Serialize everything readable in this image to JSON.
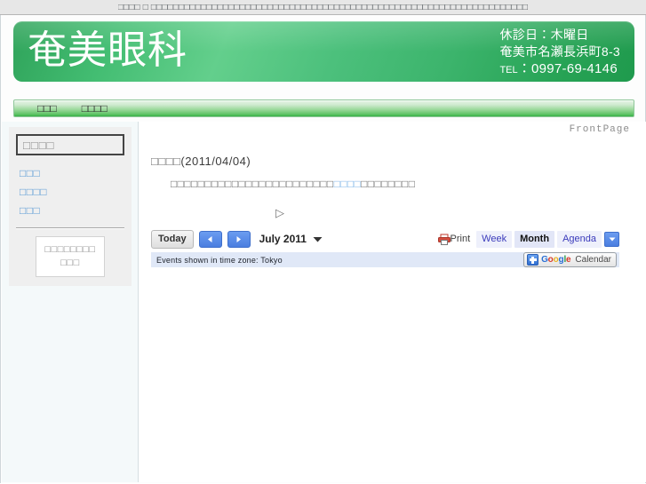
{
  "browser": {
    "title_text": "□□□□ □ □□□□□□□□□□□□□□□□□□□□□□□□□□□□□□□□□□□□□□□□□□□□□□□□□□□□□□□□□□□□□□□□□□□□"
  },
  "header": {
    "site_title": "奄美眼科",
    "closed_day": "休診日：木曜日",
    "address": "奄美市名瀬長浜町8-3",
    "tel_label": "TEL",
    "tel_separator": "：",
    "tel_number": "0997-69-4146",
    "accent_green": "#3cb46c",
    "accent_green_light": "#63cf8c",
    "accent_green_dark": "#1f9a4d"
  },
  "nav": {
    "items": [
      {
        "label": "□□□"
      },
      {
        "label": "□□□□"
      }
    ]
  },
  "sidebar": {
    "search_value": "□□□□",
    "links": [
      {
        "label": "□□□"
      },
      {
        "label": "□□□□"
      },
      {
        "label": "□□□"
      }
    ],
    "card_line1": "□□□□□□□□",
    "card_line2": "□□□",
    "link_color": "#5b9bd5"
  },
  "main": {
    "breadcrumb": "FrontPage",
    "article_title_text": "□□□□",
    "article_title_date": "(2011/04/04)",
    "article_body_pre": "□□□□□□□□□□□□□□□□□□□□□□□□",
    "article_body_link": "□□□□",
    "article_body_post": "□□□□□□□□",
    "play_marker": "▷"
  },
  "calendar": {
    "today_label": "Today",
    "prev_label": "◀",
    "next_label": "▶",
    "period_label": "July 2011",
    "period_caret": "▾",
    "print_label": "Print",
    "views": [
      {
        "label": "Week",
        "active": false
      },
      {
        "label": "Month",
        "active": true
      },
      {
        "label": "Agenda",
        "active": false
      }
    ],
    "more_caret": "▾",
    "timezone_text": "Events shown in time zone: Tokyo",
    "badge": {
      "g_letters": [
        "G",
        "o",
        "o",
        "g",
        "l",
        "e"
      ],
      "calendar_word": "Calendar"
    }
  }
}
